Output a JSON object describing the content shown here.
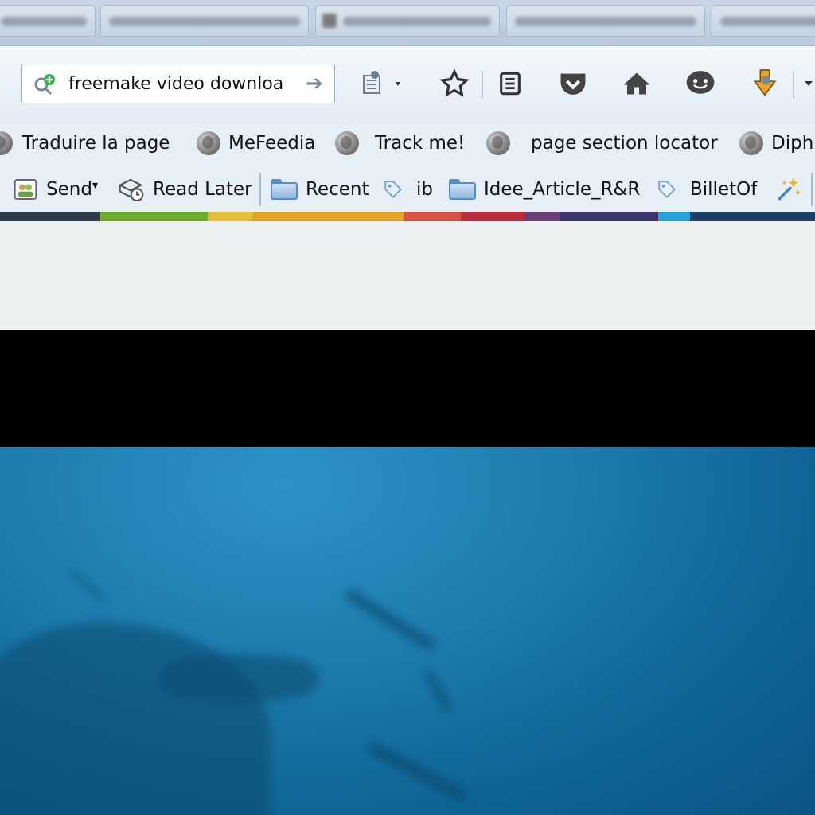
{
  "browser": {
    "url_value": "freemake video downloa",
    "icons": {
      "url": "search-plus-icon",
      "go": "go-arrow-icon",
      "reader": "reader-view-icon",
      "bookmark": "star-icon",
      "library": "reading-list-icon",
      "pocket": "pocket-icon",
      "home": "home-icon",
      "chat": "chat-icon",
      "download": "download-icon"
    }
  },
  "bookmarks_bar_1": {
    "items": [
      {
        "label": "",
        "icon": "globe-icon"
      },
      {
        "label": "Traduire la page",
        "icon": "globe-icon"
      },
      {
        "label": "MeFeedia",
        "icon": "globe-icon"
      },
      {
        "label": "Track me!",
        "icon": "globe-icon"
      },
      {
        "label": "page section locator",
        "icon": "globe-icon"
      },
      {
        "label": "Diph",
        "icon": "globe-icon"
      }
    ]
  },
  "bookmarks_bar_2": {
    "items": [
      {
        "label": "Send",
        "icon": "send-contacts-icon",
        "dropdown": "▾"
      },
      {
        "label": "Read Later",
        "icon": "read-later-icon"
      },
      {
        "label": "Recent",
        "icon": "folder-icon"
      },
      {
        "label": "ib",
        "icon": "tag-icon"
      },
      {
        "label": "Idee_Article_R&R",
        "icon": "folder-icon"
      },
      {
        "label": "BilletOf",
        "icon": "tag-icon"
      },
      {
        "label": "",
        "icon": "sparkle-tool-icon"
      }
    ]
  },
  "stripe_colors": [
    "#2e3b4a",
    "#6fab2f",
    "#e3bd3c",
    "#e4a52a",
    "#d55245",
    "#b72d3e",
    "#6a3f73",
    "#3a3268",
    "#2aa0d8",
    "#1d3e64"
  ]
}
